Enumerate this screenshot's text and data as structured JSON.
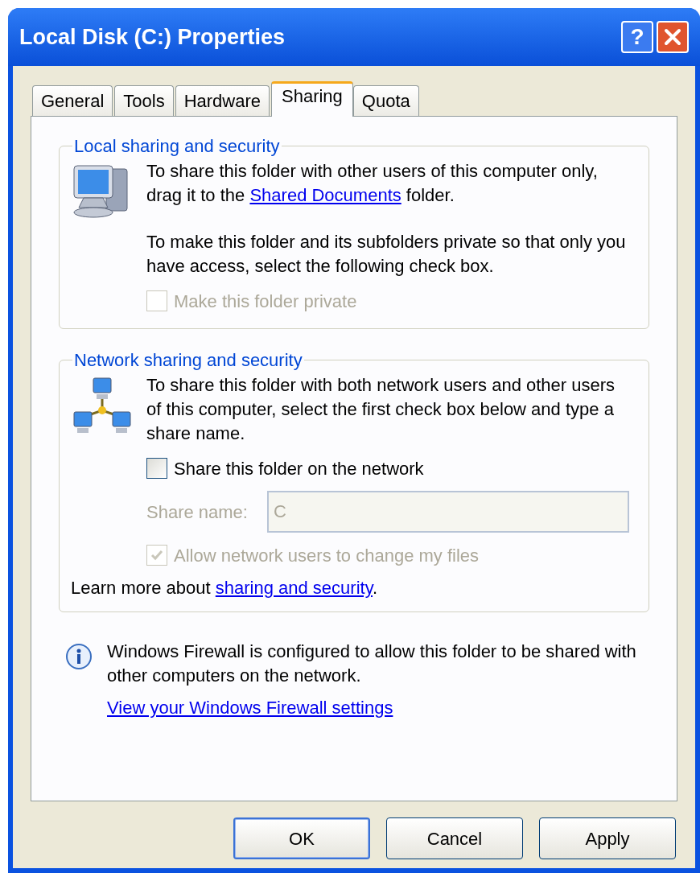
{
  "window": {
    "title": "Local Disk (C:) Properties",
    "title_buttons": [
      {
        "kind": "help",
        "label": "?"
      },
      {
        "kind": "close"
      }
    ]
  },
  "tabs": [
    {
      "label": "General",
      "selected": false
    },
    {
      "label": "Tools",
      "selected": false
    },
    {
      "label": "Hardware",
      "selected": false
    },
    {
      "label": "Sharing",
      "selected": true
    },
    {
      "label": "Quota",
      "selected": false
    }
  ],
  "groups": [
    {
      "kind": "local",
      "title": "Local sharing and security",
      "items": [
        {
          "kind": "paragraph",
          "text": "To share this folder with other users of this computer only, drag it to the ",
          "link": "Shared Documents",
          "after": " folder."
        },
        {
          "kind": "paragraph",
          "text": "To make this folder and its subfolders private so that only you have access, select the following check box."
        },
        {
          "kind": "checkbox",
          "label": "Make this folder private",
          "checked": false,
          "disabled": true
        }
      ]
    },
    {
      "kind": "network",
      "title": "Network sharing and security",
      "items": [
        {
          "kind": "paragraph",
          "text": "To share this folder with both network users and other users of this computer, select the first check box below and type a share name."
        },
        {
          "kind": "checkbox",
          "label": "Share this folder on the network",
          "checked": false,
          "disabled": false
        },
        {
          "kind": "field",
          "label": "Share name:",
          "value": "C",
          "disabled": true
        },
        {
          "kind": "checkbox",
          "label": "Allow network users to change my files",
          "checked": true,
          "disabled": true
        },
        {
          "kind": "learn",
          "text": "Learn more about ",
          "link": "sharing and security",
          "after": "."
        }
      ]
    }
  ],
  "firewall": {
    "text": "Windows Firewall is configured to allow this folder to be shared with other computers on the network.",
    "link": "View your Windows Firewall settings"
  },
  "buttons": [
    {
      "label": "OK",
      "default": true
    },
    {
      "label": "Cancel",
      "default": false
    },
    {
      "label": "Apply",
      "default": false
    }
  ]
}
